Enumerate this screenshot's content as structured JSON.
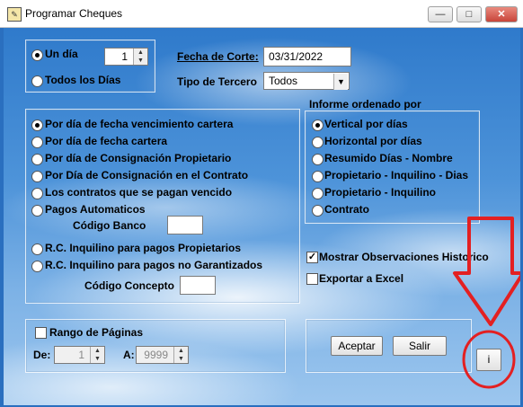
{
  "window": {
    "title": "Programar Cheques",
    "minimize": "—",
    "maximize": "□",
    "close": "✕"
  },
  "period": {
    "un_dia": "Un día",
    "un_dia_value": "1",
    "todos_los_dias": "Todos los Días",
    "fecha_corte_label": "Fecha de Corte:",
    "fecha_corte_value": "03/31/2022",
    "tipo_tercero_label": "Tipo de Tercero",
    "tipo_tercero_value": "Todos"
  },
  "filters": {
    "options": [
      "Por día de fecha vencimiento cartera",
      "Por día de fecha cartera",
      "Por día de Consignación Propietario",
      "Por Día de Consignación en el Contrato",
      "Los contratos que se pagan vencido",
      "Pagos Automaticos"
    ],
    "codigo_banco_label": "Código Banco",
    "codigo_banco_value": "",
    "rc_options": [
      "R.C. Inquilino para pagos Propietarios",
      "R.C. Inquilino para pagos no Garantizados"
    ],
    "codigo_concepto_label": "Código Concepto",
    "codigo_concepto_value": ""
  },
  "order": {
    "title": "Informe ordenado por",
    "options": [
      "Vertical por días",
      "Horizontal por días",
      "Resumido Días - Nombre",
      "Propietario - Inquilino - Dias",
      "Propietario - Inquilino",
      "Contrato"
    ]
  },
  "checks": {
    "mostrar_obs": "Mostrar Observaciones Historico",
    "mostrar_obs_checked": true,
    "exportar_excel": "Exportar a Excel",
    "exportar_excel_checked": false
  },
  "pages": {
    "rango_label": "Rango de Páginas",
    "de_label": "De:",
    "de_value": "1",
    "a_label": "A:",
    "a_value": "9999"
  },
  "actions": {
    "aceptar": "Aceptar",
    "salir": "Salir",
    "info": "i"
  },
  "annotation_color": "#e32022"
}
